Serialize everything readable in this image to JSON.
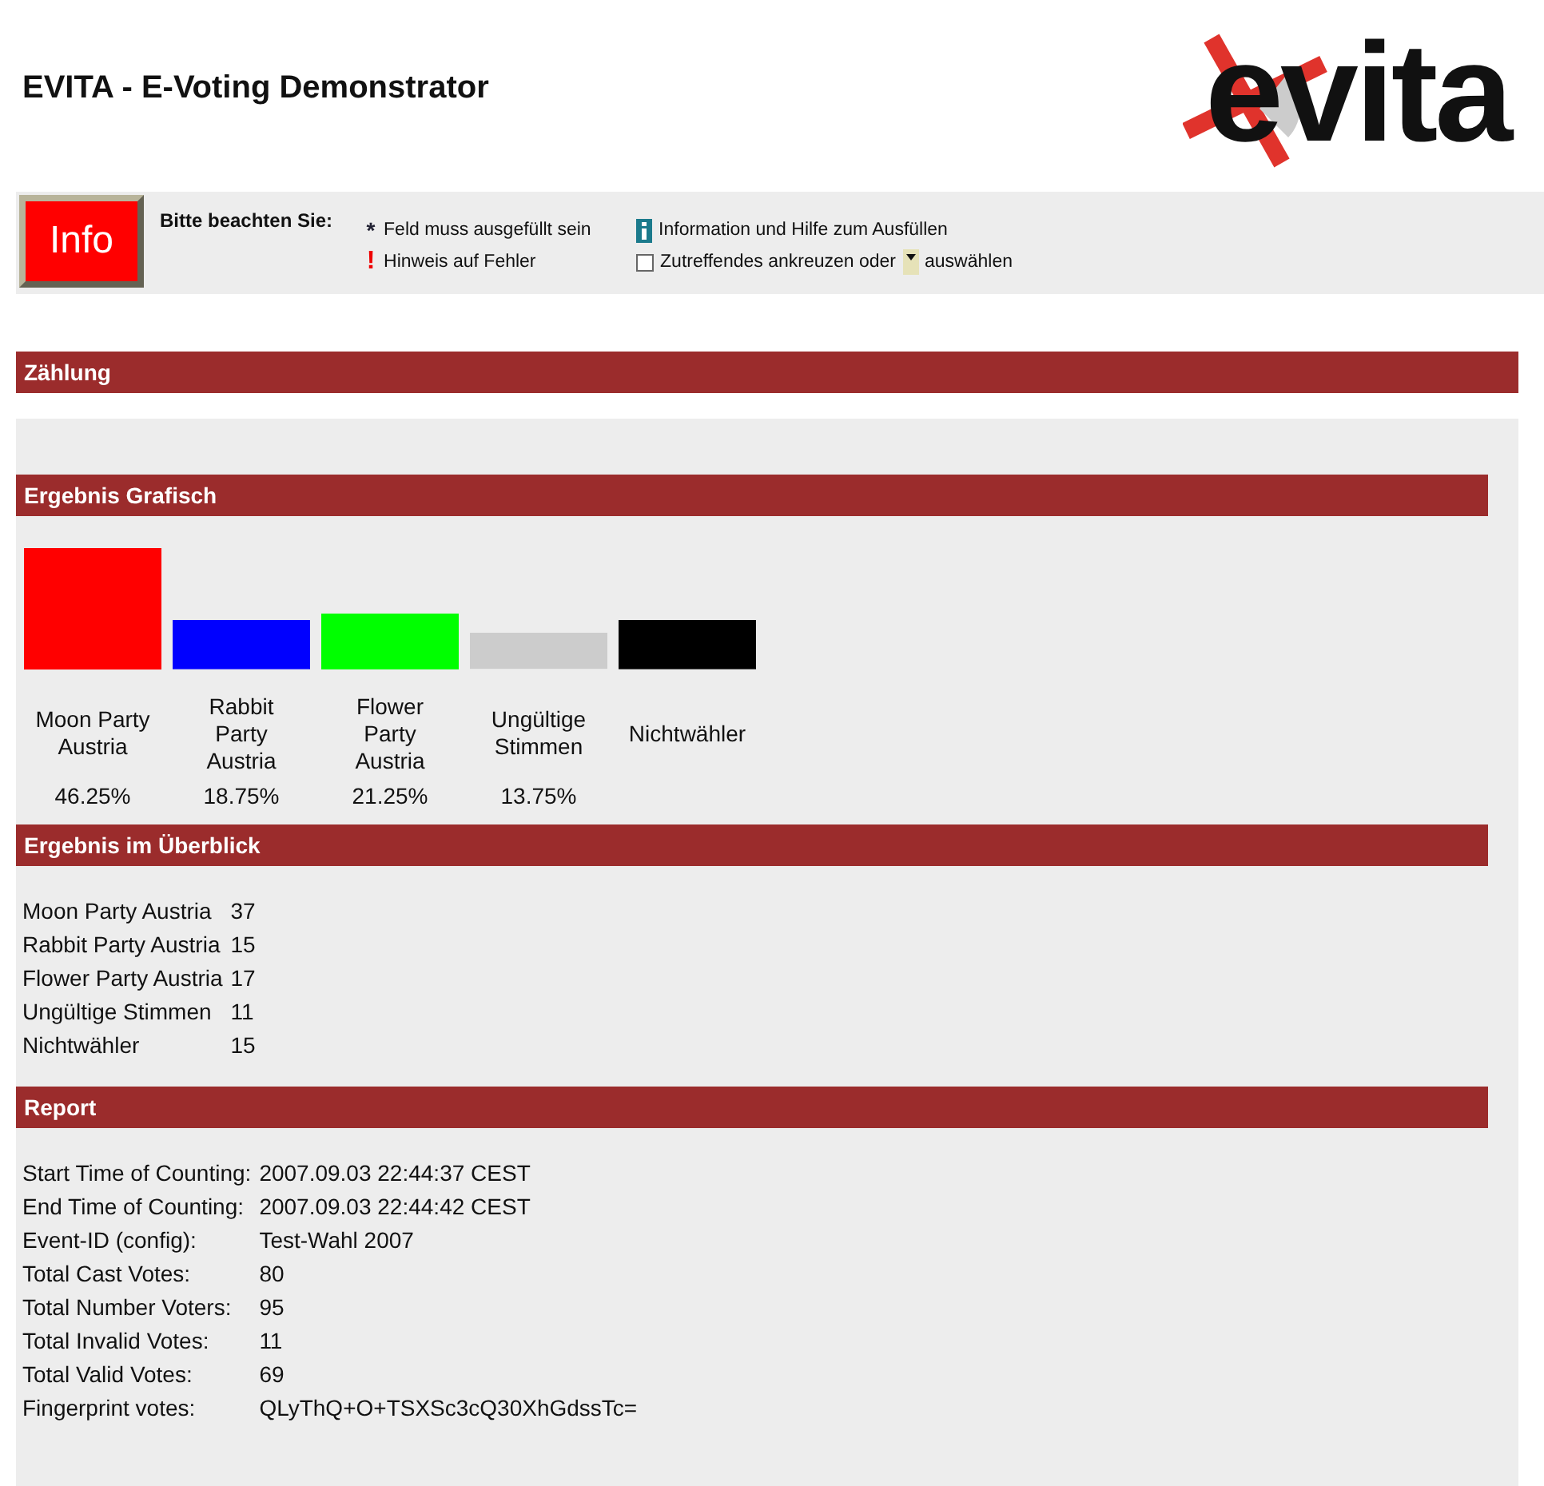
{
  "header": {
    "title": "EVITA - E-Voting Demonstrator",
    "logo": "evita"
  },
  "info": {
    "button": "Info",
    "heading": "Bitte beachten Sie:",
    "legend": [
      {
        "kind": "star",
        "symbol": "*",
        "text": "Feld muss ausgefüllt sein"
      },
      {
        "kind": "info",
        "text": "Information und Hilfe zum Ausfüllen"
      },
      {
        "kind": "error",
        "symbol": "!",
        "text": "Hinweis auf Fehler"
      },
      {
        "kind": "check",
        "text": "Zutreffendes ankreuzen oder",
        "after": "auswählen"
      }
    ]
  },
  "counting": {
    "title": "Zählung"
  },
  "graphic": {
    "title": "Ergebnis Grafisch",
    "chart_data": {
      "type": "bar",
      "categories": [
        "Moon Party Austria",
        "Rabbit Party Austria",
        "Flower Party Austria",
        "Ungültige Stimmen",
        "Nichtwähler"
      ],
      "values": [
        46.25,
        18.75,
        21.25,
        13.75,
        18.75
      ],
      "colors": [
        "#ff0000",
        "#0000ff",
        "#00ff00",
        "#cccccc",
        "#000000"
      ],
      "value_labels": [
        "46.25%",
        "18.75%",
        "21.25%",
        "13.75%",
        null
      ]
    }
  },
  "overview": {
    "title": "Ergebnis im Überblick",
    "rows": [
      {
        "name": "Moon Party Austria",
        "count": "37"
      },
      {
        "name": "Rabbit Party Austria",
        "count": "15"
      },
      {
        "name": "Flower Party Austria",
        "count": "17"
      },
      {
        "name": "Ungültige Stimmen",
        "count": "11"
      },
      {
        "name": "Nichtwähler",
        "count": "15"
      }
    ]
  },
  "report": {
    "title": "Report",
    "rows": [
      {
        "label": "Start Time of Counting:",
        "value": "2007.09.03 22:44:37 CEST"
      },
      {
        "label": "End Time of Counting:",
        "value": "2007.09.03 22:44:42 CEST"
      },
      {
        "label": "Event-ID (config):",
        "value": "Test-Wahl 2007"
      },
      {
        "label": "Total Cast Votes:",
        "value": "80"
      },
      {
        "label": "Total Number Voters:",
        "value": "95"
      },
      {
        "label": "Total Invalid Votes:",
        "value": "11"
      },
      {
        "label": "Total Valid Votes:",
        "value": "69"
      },
      {
        "label": "Fingerprint votes:",
        "value": "QLyThQ+O+TSXSc3cQ30XhGdssTc="
      }
    ]
  }
}
